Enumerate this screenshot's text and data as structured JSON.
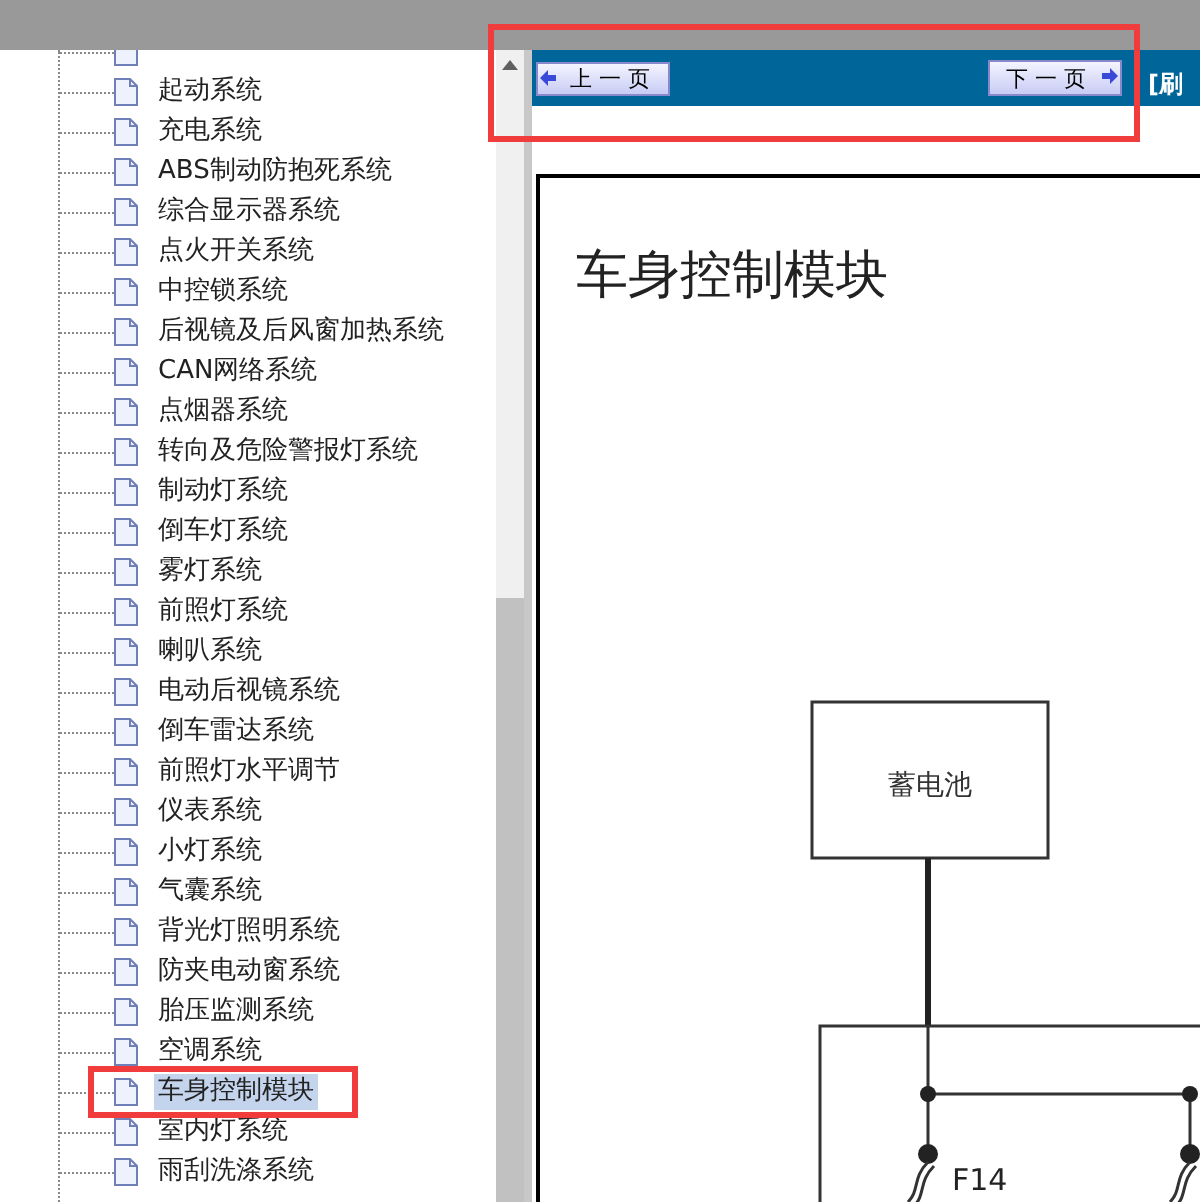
{
  "tree": {
    "items": [
      {
        "label": "起动系统",
        "selected": false
      },
      {
        "label": "充电系统",
        "selected": false
      },
      {
        "label": "ABS制动防抱死系统",
        "selected": false
      },
      {
        "label": "综合显示器系统",
        "selected": false
      },
      {
        "label": "点火开关系统",
        "selected": false
      },
      {
        "label": "中控锁系统",
        "selected": false
      },
      {
        "label": "后视镜及后风窗加热系统",
        "selected": false
      },
      {
        "label": "CAN网络系统",
        "selected": false
      },
      {
        "label": "点烟器系统",
        "selected": false
      },
      {
        "label": "转向及危险警报灯系统",
        "selected": false
      },
      {
        "label": "制动灯系统",
        "selected": false
      },
      {
        "label": "倒车灯系统",
        "selected": false
      },
      {
        "label": "雾灯系统",
        "selected": false
      },
      {
        "label": "前照灯系统",
        "selected": false
      },
      {
        "label": "喇叭系统",
        "selected": false
      },
      {
        "label": "电动后视镜系统",
        "selected": false
      },
      {
        "label": "倒车雷达系统",
        "selected": false
      },
      {
        "label": "前照灯水平调节",
        "selected": false
      },
      {
        "label": "仪表系统",
        "selected": false
      },
      {
        "label": "小灯系统",
        "selected": false
      },
      {
        "label": "气囊系统",
        "selected": false
      },
      {
        "label": "背光灯照明系统",
        "selected": false
      },
      {
        "label": "防夹电动窗系统",
        "selected": false
      },
      {
        "label": "胎压监测系统",
        "selected": false
      },
      {
        "label": "空调系统",
        "selected": false
      },
      {
        "label": "车身控制模块",
        "selected": true
      },
      {
        "label": "室内灯系统",
        "selected": false
      },
      {
        "label": "雨刮洗涤系统",
        "selected": false
      }
    ]
  },
  "toolbar": {
    "prev_button": "上 一 页",
    "next_button": "下 一 页",
    "link": "[刷"
  },
  "document": {
    "title": "车身控制模块",
    "battery_label": "蓄电池",
    "fuse_label": "F14"
  }
}
